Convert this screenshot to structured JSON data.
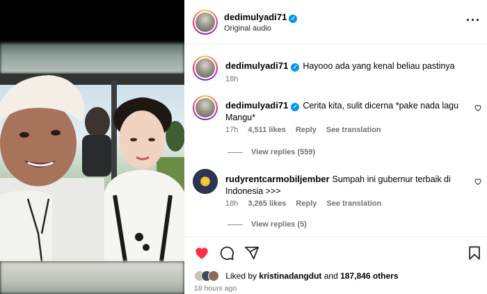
{
  "post": {
    "username": "dedimulyadi71",
    "subtitle": "Original audio"
  },
  "caption": {
    "username": "dedimulyadi71",
    "text": "Hayooo ada yang kenal beliau pastinya",
    "time": "18h"
  },
  "comments": [
    {
      "username": "dedimulyadi71",
      "verified": true,
      "text": "Cerita kita, sulit dicerna *pake nada lagu Mangu*",
      "time": "17h",
      "likes": "4,511 likes",
      "reply": "Reply",
      "translate": "See translation",
      "view_replies": "View replies (559)"
    },
    {
      "username": "rudyrentcarmobiljember",
      "verified": false,
      "text": "Sumpah ini gubernur terbaik di Indonesia >>>",
      "time": "18h",
      "likes": "3,265 likes",
      "reply": "Reply",
      "translate": "See translation",
      "view_replies": "View replies (5)"
    }
  ],
  "liked_by": {
    "prefix": "Liked by",
    "user": "kristinadangdut",
    "and": "and",
    "others": "187,846 others"
  },
  "timestamp": "18 hours ago",
  "icons": [
    "verified-badge",
    "more-icon",
    "heart-icon",
    "comment-icon",
    "share-icon",
    "bookmark-icon"
  ],
  "colors": {
    "verified": "#0095f6",
    "like_red": "#ff3040",
    "meta_gray": "#737373"
  }
}
